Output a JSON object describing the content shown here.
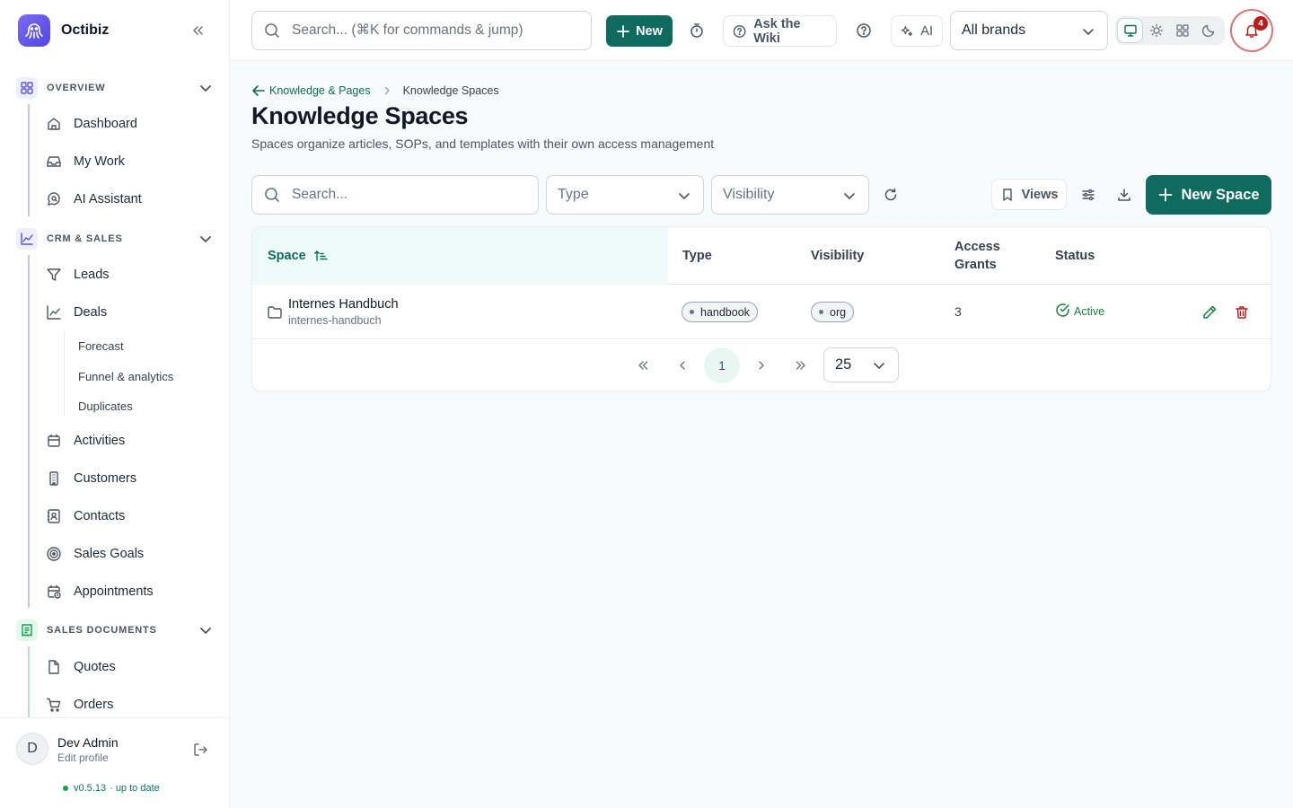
{
  "app": {
    "name": "Octibiz"
  },
  "sidebar": {
    "sections": [
      {
        "label": "OVERVIEW",
        "items": [
          "Dashboard",
          "My Work",
          "AI Assistant"
        ]
      },
      {
        "label": "CRM & SALES",
        "items": [
          "Leads",
          "Deals",
          "Activities",
          "Customers",
          "Contacts",
          "Sales Goals",
          "Appointments"
        ],
        "deals_subitems": [
          "Forecast",
          "Funnel & analytics",
          "Duplicates"
        ]
      },
      {
        "label": "SALES DOCUMENTS",
        "items": [
          "Quotes",
          "Orders"
        ]
      }
    ],
    "user": {
      "initial": "D",
      "name": "Dev Admin",
      "subtitle": "Edit profile"
    },
    "version": "v0.5.13",
    "version_status": "· up to date"
  },
  "topbar": {
    "search_placeholder": "Search... (⌘K for commands & jump)",
    "new_label": "New",
    "wiki_label": "Ask the Wiki",
    "ai_label": "AI",
    "brand_select": "All brands",
    "notification_count": "4"
  },
  "page": {
    "breadcrumb": {
      "parent": "Knowledge & Pages",
      "current": "Knowledge Spaces"
    },
    "title": "Knowledge Spaces",
    "subtitle": "Spaces organize articles, SOPs, and templates with their own access management"
  },
  "toolbar": {
    "search_placeholder": "Search...",
    "type_placeholder": "Type",
    "visibility_placeholder": "Visibility",
    "views_label": "Views",
    "new_space_label": "New Space"
  },
  "table": {
    "columns": {
      "space": "Space",
      "type": "Type",
      "visibility": "Visibility",
      "grants_line1": "Access",
      "grants_line2": "Grants",
      "status": "Status"
    },
    "rows": [
      {
        "name": "Internes Handbuch",
        "slug": "internes-handbuch",
        "type": "handbook",
        "visibility": "org",
        "access_grants": "3",
        "status": "Active"
      }
    ]
  },
  "pagination": {
    "current_page": "1",
    "per_page": "25"
  },
  "colors": {
    "primary": "#0f6b5e",
    "danger": "#b91c1c",
    "success": "#15803d",
    "brand": "#5b50e6"
  }
}
